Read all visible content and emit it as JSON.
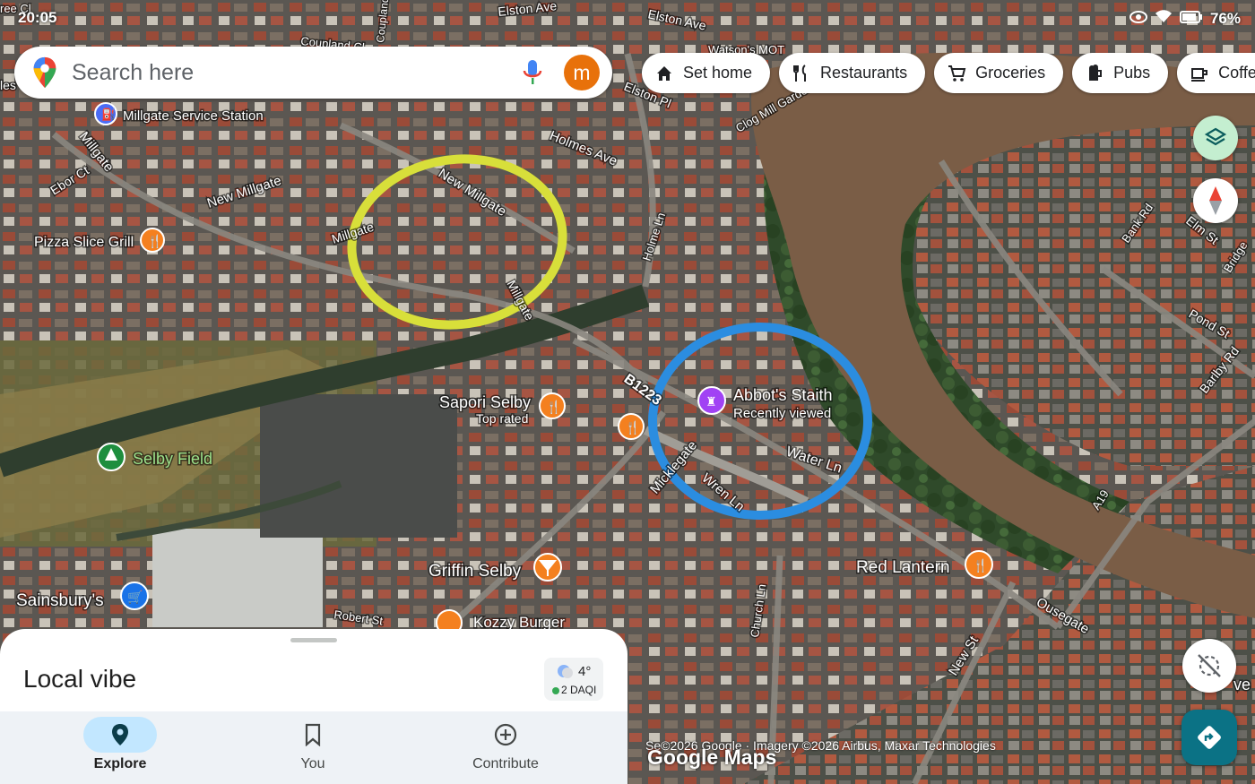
{
  "status_bar": {
    "time": "20:05",
    "battery": "76%"
  },
  "search": {
    "placeholder": "Search here",
    "avatar_letter": "m"
  },
  "chips": [
    {
      "label": "Set home",
      "icon": "home-icon"
    },
    {
      "label": "Restaurants",
      "icon": "restaurant-icon"
    },
    {
      "label": "Groceries",
      "icon": "cart-icon"
    },
    {
      "label": "Pubs",
      "icon": "pub-icon"
    },
    {
      "label": "Coffe",
      "icon": "coffee-icon"
    }
  ],
  "map": {
    "streets": [
      "Elston Ave",
      "Elston Ave",
      "Coupland Cl",
      "Coupland Rd",
      "Elston Pl",
      "Watson's MOT",
      "Clog Mill Gardens",
      "Holmes Ave",
      "Millgate",
      "Ebor Ct",
      "New Millgate",
      "New Millgate",
      "Millgate",
      "Millgate",
      "Holme Ln",
      "Bank Rd",
      "Elm St",
      "Bridge",
      "Pond St",
      "Barlby Rd",
      "B1223",
      "Micklegate",
      "Wren Ln",
      "Water Ln",
      "Church Ln",
      "New St",
      "Ousegate",
      "A19",
      "Robert St"
    ],
    "places": [
      {
        "name": "Millgate Service Station",
        "icon": "fuel-icon"
      },
      {
        "name": "Pizza Slice Grill",
        "icon": "restaurant-icon"
      },
      {
        "name": "Sapori Selby",
        "sub": "Top rated",
        "icon": "restaurant-icon"
      },
      {
        "name": "Abbot's Staith",
        "sub": "Recently viewed",
        "icon": "castle-icon"
      },
      {
        "name": "Selby Field",
        "icon": "park-icon"
      },
      {
        "name": "Griffin Selby",
        "icon": "bar-icon"
      },
      {
        "name": "Red Lantern",
        "icon": "restaurant-icon"
      },
      {
        "name": "Sainsbury's",
        "icon": "shopping-cart-icon"
      },
      {
        "name": "Kozzy Burger",
        "icon": "restaurant-icon"
      }
    ],
    "annotations": [
      {
        "color": "#d8df3a",
        "shape": "circle"
      },
      {
        "color": "#2b8de0",
        "shape": "circle"
      }
    ],
    "edge_labels": [
      "les",
      "ree Cl",
      "ve"
    ]
  },
  "attribution": {
    "copyright": "©2026 Google · Imagery ©2026 Airbus, Maxar Technologies",
    "logo": "Google Maps",
    "partial": "Se"
  },
  "sheet": {
    "title": "Local vibe",
    "weather_temp": "4°",
    "weather_aqi": "2 DAQI"
  },
  "nav": [
    {
      "label": "Explore",
      "icon": "location-pin-icon",
      "active": true
    },
    {
      "label": "You",
      "icon": "bookmark-icon",
      "active": false
    },
    {
      "label": "Contribute",
      "icon": "add-circle-icon",
      "active": false
    }
  ],
  "colors": {
    "river": "#7a5d46",
    "aqi_dot": "#34a853",
    "directions": "#0b7285",
    "accent": "#1a73e8",
    "annotation_yellow": "#d8df3a",
    "annotation_blue": "#2b8de0"
  }
}
